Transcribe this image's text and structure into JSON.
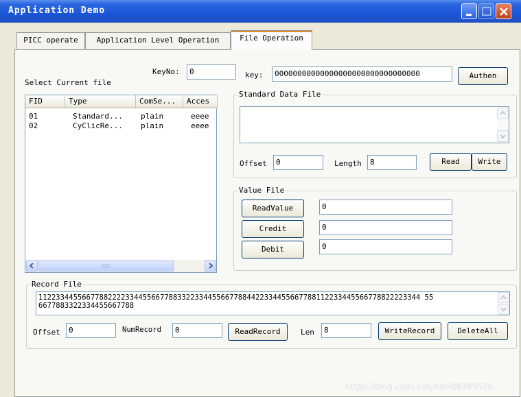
{
  "window": {
    "title": "Application Demo"
  },
  "tabs": [
    {
      "label": "PICC operate"
    },
    {
      "label": "Application Level Operation"
    },
    {
      "label": "File Operation"
    }
  ],
  "auth": {
    "keyno_label": "KeyNo:",
    "keyno_value": "0",
    "key_label": "key:",
    "key_value": "00000000000000000000000000000000",
    "authen_label": "Authen"
  },
  "file_list": {
    "label": "Select Current file",
    "columns": [
      "FID",
      "Type",
      "ComSe...",
      "Acces"
    ],
    "rows": [
      [
        "01",
        "Standard...",
        "plain",
        "eeee"
      ],
      [
        "02",
        "CyClicRe...",
        "plain",
        "eeee"
      ]
    ]
  },
  "standard_file": {
    "legend": "Standard Data File",
    "content": "",
    "offset_label": "Offset",
    "offset_value": "0",
    "length_label": "Length",
    "length_value": "8",
    "read_label": "Read",
    "write_label": "Write"
  },
  "value_file": {
    "legend": "Value File",
    "read_value_label": "ReadValue",
    "read_value": "0",
    "credit_label": "Credit",
    "credit_value": "0",
    "debit_label": "Debit",
    "debit_value": "0"
  },
  "record_file": {
    "legend": "Record File",
    "content_line1": "1122334455667788222233445566778833223344556677884422334455667788112233445566778822223344 55",
    "content_line2": "6677883322334455667788",
    "offset_label": "Offset",
    "offset_value": "0",
    "numrecord_label": "NumRecord",
    "numrecord_value": "0",
    "readrecord_label": "ReadRecord",
    "len_label": "Len",
    "len_value": "8",
    "writerecord_label": "WriteRecord",
    "deleteall_label": "DeleteAll"
  },
  "watermark": "https://blog.csdn.net/Alex88389516",
  "colors": {
    "titlebar": "#1a56d6",
    "window_bg": "#ece9d8",
    "tab_highlight": "#e68b2c"
  }
}
